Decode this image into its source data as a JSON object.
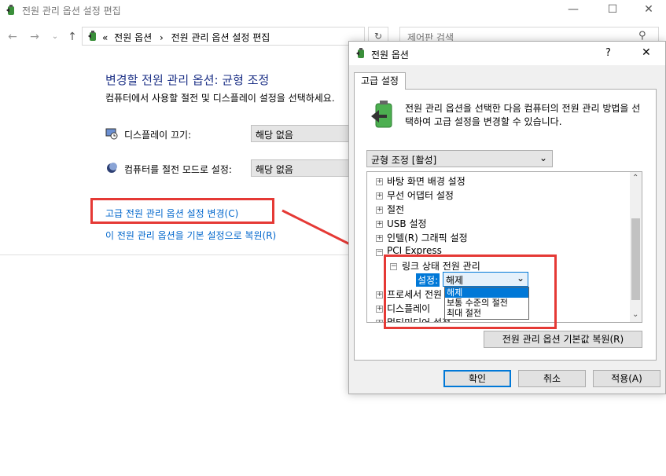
{
  "main_window": {
    "title": "전원 관리 옵션 설정 편집",
    "breadcrumb_sep": "«",
    "breadcrumb_1": "전원 옵션",
    "breadcrumb_arrow": "›",
    "breadcrumb_2": "전원 관리 옵션 설정 편집",
    "search_placeholder": "제어판 검색",
    "heading": "변경할 전원 관리 옵션: 균형 조정",
    "subtext": "컴퓨터에서 사용할 절전 및 디스플레이 설정을 선택하세요.",
    "display_off_label": "디스플레이 끄기:",
    "display_off_value": "해당 없음",
    "sleep_label": "컴퓨터를 절전 모드로 설정:",
    "sleep_value": "해당 없음",
    "advanced_link": "고급 전원 관리 옵션 설정 변경(C)",
    "restore_link": "이 전원 관리 옵션을 기본 설정으로 복원(R)"
  },
  "dialog": {
    "title": "전원 옵션",
    "help": "?",
    "close": "✕",
    "tab": "고급 설정",
    "description": "전원 관리 옵션을 선택한 다음 컴퓨터의 전원 관리 방법을 선택하여 고급 설정을 변경할 수 있습니다.",
    "plan_value": "균형 조정 [활성]",
    "tree": [
      {
        "label": "바탕 화면 배경 설정",
        "expander": "+"
      },
      {
        "label": "무선 어댑터 설정",
        "expander": "+"
      },
      {
        "label": "절전",
        "expander": "+"
      },
      {
        "label": "USB 설정",
        "expander": "+"
      },
      {
        "label": "인텔(R) 그래픽 설정",
        "expander": "+"
      },
      {
        "label": "PCI Express",
        "expander": "−"
      },
      {
        "label": "링크 상태 전원 관리",
        "expander": "−"
      },
      {
        "label": "프로세서 전원 관리",
        "expander": "+"
      },
      {
        "label": "디스플레이",
        "expander": "+"
      },
      {
        "label": "멀티미디어 설정",
        "expander": "+"
      }
    ],
    "setting_label": "설정:",
    "setting_value": "해제",
    "dropdown_options": [
      "해제",
      "보통 수준의 절전",
      "최대 절전"
    ],
    "restore_button": "전원 관리 옵션 기본값 복원(R)",
    "ok": "확인",
    "cancel": "취소",
    "apply": "적용(A)"
  },
  "colors": {
    "highlight": "#0078d7",
    "annotation_red": "#e53935",
    "heading_blue": "#1e3287",
    "link_blue": "#0066cc"
  }
}
